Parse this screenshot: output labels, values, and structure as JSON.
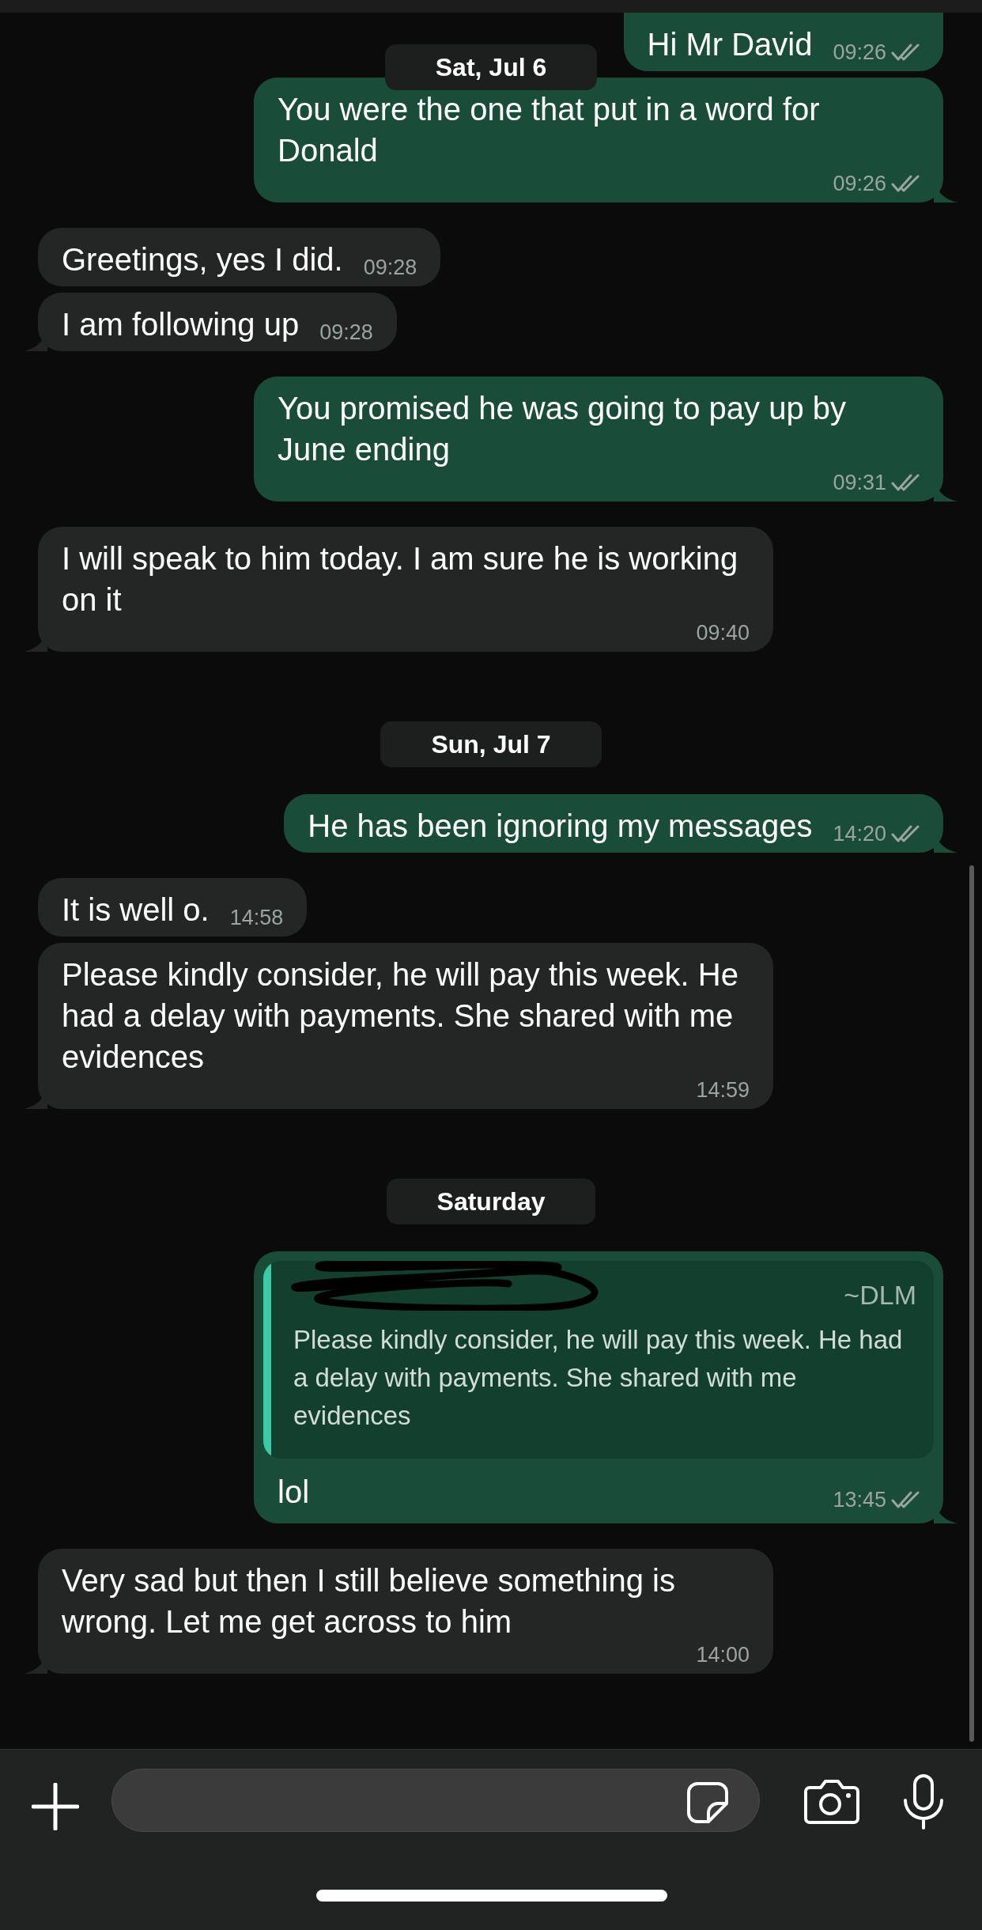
{
  "sticky_date": "Sat, Jul 6",
  "messages": [
    {
      "kind": "message",
      "outgoing": true,
      "text": "Hi Mr David",
      "time": "09:26",
      "read": false
    },
    {
      "kind": "message",
      "outgoing": true,
      "text": "You were the one that put in a word for Donald",
      "time": "09:26",
      "read": false
    },
    {
      "kind": "message",
      "outgoing": false,
      "text": "Greetings, yes I did.",
      "time": "09:28"
    },
    {
      "kind": "message",
      "outgoing": false,
      "text": "I am following up",
      "time": "09:28"
    },
    {
      "kind": "message",
      "outgoing": true,
      "text": "You promised he was going to pay up by June ending",
      "time": "09:31",
      "read": false
    },
    {
      "kind": "message",
      "outgoing": false,
      "text": "I will speak to him today. I am sure he is working on it",
      "time": "09:40"
    },
    {
      "kind": "date",
      "text": "Sun, Jul 7"
    },
    {
      "kind": "message",
      "outgoing": true,
      "text": "He has been ignoring my messages",
      "time": "14:20",
      "read": false
    },
    {
      "kind": "message",
      "outgoing": false,
      "text": "It is well o.",
      "time": "14:58"
    },
    {
      "kind": "message",
      "outgoing": false,
      "text": "Please kindly consider, he will pay this week. He had a delay with payments. She shared with me evidences",
      "time": "14:59"
    },
    {
      "kind": "date",
      "text": "Saturday"
    },
    {
      "kind": "message",
      "outgoing": true,
      "text": "lol",
      "time": "13:45",
      "read": false,
      "quote": {
        "author_redacted": true,
        "sender_name": "~DLM",
        "text": "Please kindly consider, he will pay this week. He had a delay with payments. She shared with me evidences"
      }
    },
    {
      "kind": "message",
      "outgoing": false,
      "text": "Very sad but then I still believe something is wrong. Let me get across to him",
      "time": "14:00"
    }
  ]
}
